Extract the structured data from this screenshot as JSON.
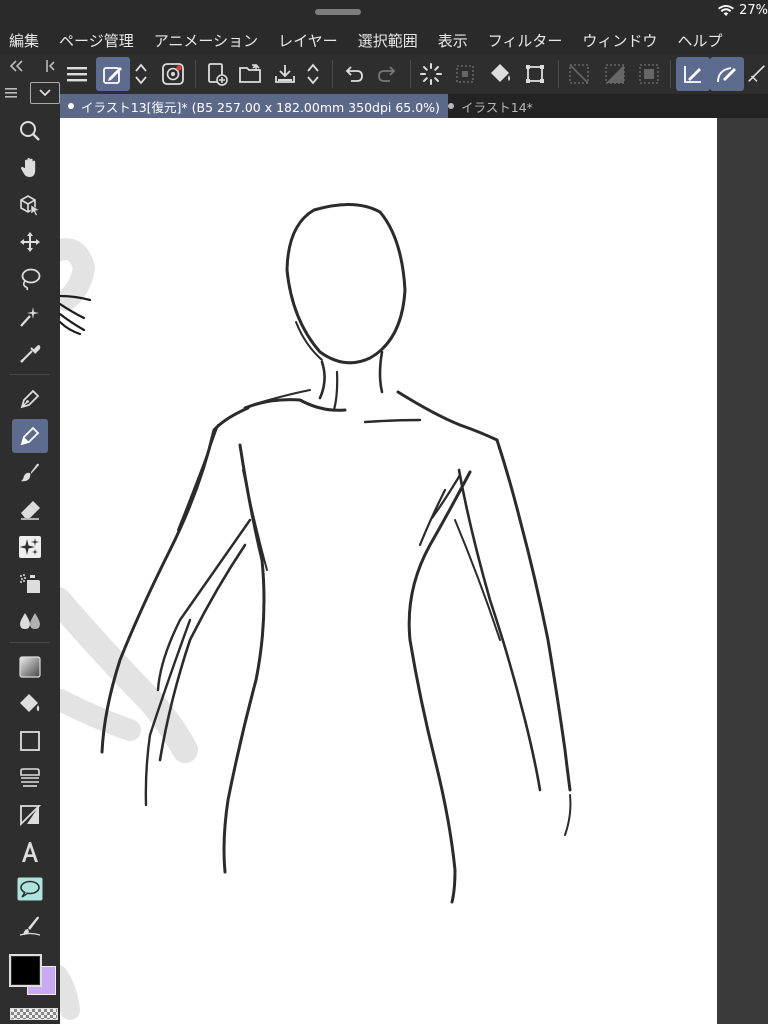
{
  "status": {
    "battery_text": "27%"
  },
  "menu": {
    "items": [
      "編集",
      "ページ管理",
      "アニメーション",
      "レイヤー",
      "選択範囲",
      "表示",
      "フィルター",
      "ウィンドウ",
      "ヘルプ"
    ]
  },
  "tabs": [
    {
      "label": "イラスト13[復元]* (B5 257.00 x 182.00mm 350dpi 65.0%)",
      "active": true
    },
    {
      "label": "イラスト14*",
      "active": false
    }
  ],
  "command_bar": {
    "buttons": [
      "menu-icon",
      "snap-tool-icon",
      "swap-vertical-icon",
      "record-icon",
      "new-canvas-icon",
      "open-folder-icon",
      "save-icon",
      "swap-vertical-icon",
      "undo-icon",
      "redo-icon",
      "loading-spinner-icon",
      "transform-selection-icon",
      "fill-bucket-icon",
      "bounding-box-icon",
      "hide-selection-icon",
      "invert-selection-icon",
      "clear-selection-icon",
      "snap-ruler-icon",
      "snap-special-ruler-icon",
      "snap-grid-icon"
    ]
  },
  "tools": [
    "zoom-icon",
    "hand-icon",
    "object-select-icon",
    "move-layer-icon",
    "lasso-icon",
    "auto-select-icon",
    "eyedropper-icon",
    "pen-icon",
    "pencil-icon",
    "brush-icon",
    "eraser-icon",
    "sparkle-decoration-icon",
    "airbrush-icon",
    "blend-icon",
    "gradient-icon",
    "fill-icon",
    "rectangle-icon",
    "ruler-icon",
    "frame-icon",
    "text-icon",
    "balloon-icon",
    "correct-line-icon"
  ],
  "colors": {
    "main_color": "#000000",
    "sub_color": "#c9a9f2",
    "accent": "#5d6b8e",
    "background": "#2e2e2e"
  }
}
